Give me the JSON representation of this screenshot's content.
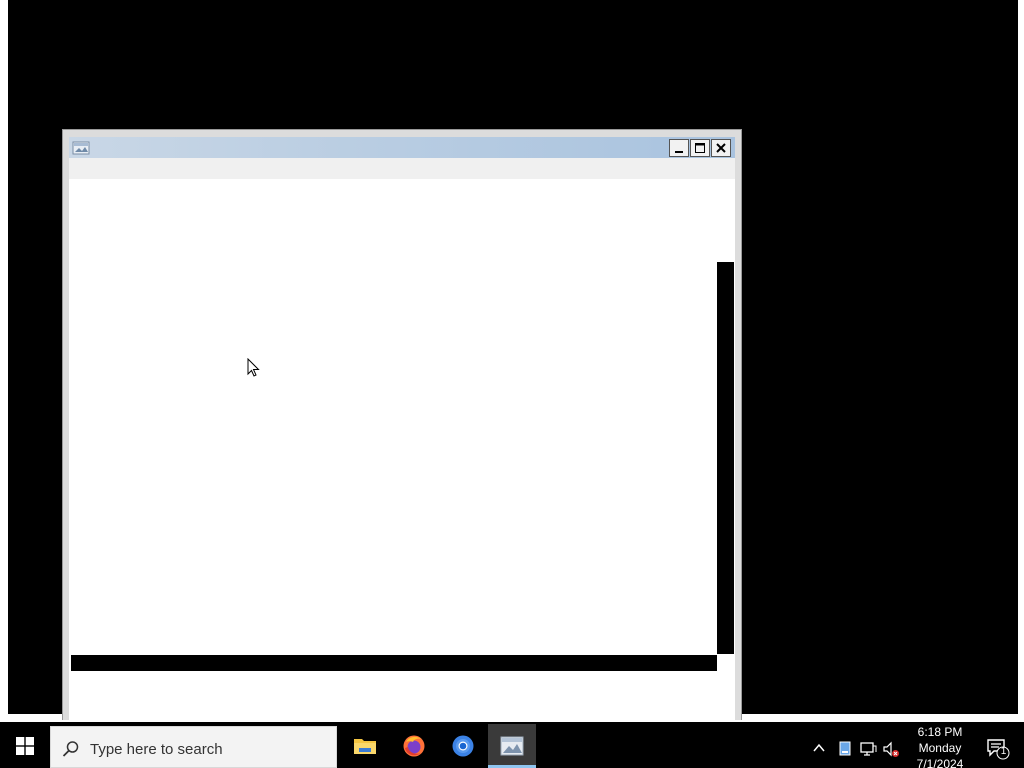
{
  "window": {
    "title": "",
    "icon": "app-window-icon",
    "buttons": {
      "minimize": "minimize-icon",
      "maximize": "maximize-icon",
      "close": "close-icon"
    }
  },
  "taskbar": {
    "search_placeholder": "Type here to search",
    "apps": [
      {
        "name": "file-explorer",
        "icon": "folder-icon"
      },
      {
        "name": "firefox",
        "icon": "firefox-icon"
      },
      {
        "name": "chrome",
        "icon": "chrome-icon"
      },
      {
        "name": "active-app",
        "icon": "app-window-icon",
        "active": true
      }
    ],
    "clock": {
      "time": "6:18 PM",
      "day": "Monday",
      "date": "7/1/2024"
    },
    "notifications_count": "1"
  },
  "colors": {
    "desktop": "#000000",
    "titlebar_start": "#c9d7e6",
    "titlebar_end": "#a9c3df",
    "taskbar": "#000000",
    "search_bg": "#f3f3f3",
    "active_indicator": "#8ec5f0"
  }
}
